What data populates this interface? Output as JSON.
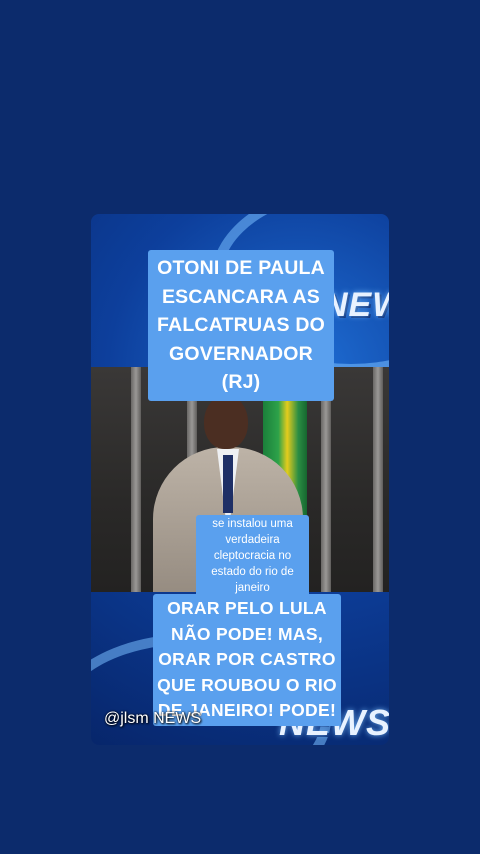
{
  "video": {
    "top_caption": "OTONI DE PAULA ESCANCARA AS FALCATRUAS DO GOVERNADOR (RJ)",
    "subtitle": "se instalou uma verdadeira cleptocracia no estado do rio de janeiro",
    "bottom_caption": "ORAR PELO LULA NÃO PODE! MAS, ORAR POR CASTRO QUE ROUBOU O RIO DE JANEIRO! PODE!",
    "watermark": "@jlsm NEWS",
    "news_logo_text": "NEWS"
  },
  "colors": {
    "page_background": "#0c2b6c",
    "caption_background": "#5aa0ee",
    "caption_text": "#ffffff"
  }
}
